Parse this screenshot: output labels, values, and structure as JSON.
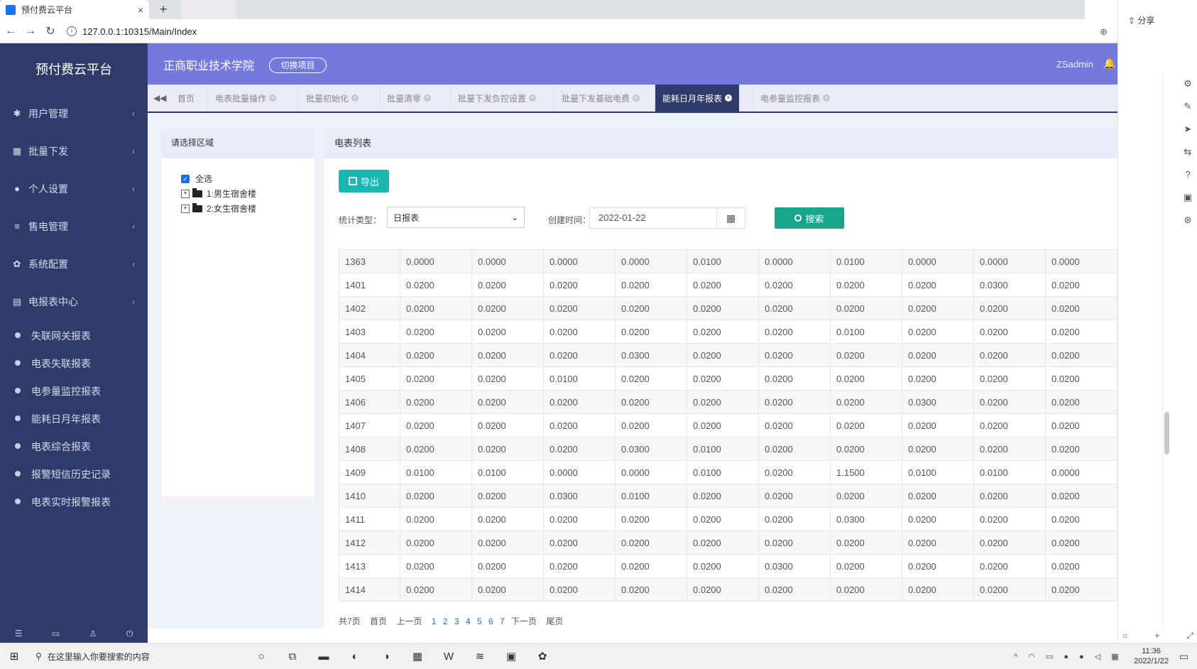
{
  "browser": {
    "tab_title": "预付费云平台",
    "tab_close": "×",
    "new_tab": "+",
    "back": "←",
    "forward": "→",
    "reload": "↻",
    "info": "i",
    "url": "127.0.0.1:10315/Main/Index",
    "zoom": "⊕",
    "share": "分享",
    "side_tools": [
      "⚙",
      "✎",
      "➤",
      "⇆",
      "?",
      "▣",
      "⊛"
    ],
    "side_bottom": [
      "○",
      "+",
      "⤢"
    ]
  },
  "sidebar": {
    "brand": "预付费云平台",
    "menu": [
      {
        "label": "用户管理",
        "icon": "✱"
      },
      {
        "label": "批量下发",
        "icon": "▦"
      },
      {
        "label": "个人设置",
        "icon": "●"
      },
      {
        "label": "售电管理",
        "icon": "≡"
      },
      {
        "label": "系统配置",
        "icon": "✿"
      },
      {
        "label": "电报表中心",
        "icon": "▤"
      }
    ],
    "chevron": "‹",
    "submenu": [
      "失联网关报表",
      "电表失联报表",
      "电参量监控报表",
      "能耗日月年报表",
      "电表综合报表",
      "报警短信历史记录",
      "电表实时报警报表"
    ],
    "footer_icons": [
      "☰",
      "▭",
      "♙",
      "⏻"
    ]
  },
  "header": {
    "org_name": "正商职业技术学院",
    "switch_label": "切换项目",
    "user": "ZSadmin",
    "bell": "🔔"
  },
  "tabs": {
    "back": "◀◀",
    "items": [
      "首页",
      "电表批量操作",
      "批量初始化",
      "批量清零",
      "批量下发负控设置",
      "批量下发基础电费",
      "能耗日月年报表",
      "电参量监控报表"
    ],
    "close": "×"
  },
  "region": {
    "title": "请选择区域",
    "check_all": "全选",
    "check_mark": "✓",
    "plus": "+",
    "nodes": [
      "1:男生宿舍楼",
      "2:女生宿舍楼"
    ]
  },
  "meters": {
    "title": "电表列表",
    "export_label": "导出",
    "stat_type_label": "统计类型：",
    "stat_type_value": "日报表",
    "select_arrow": "⌄",
    "create_time_label": "创建时间：",
    "create_time_value": "2022-01-22",
    "calendar_icon": "▦",
    "search_label": "搜索",
    "rows": [
      [
        "1363",
        "0.0000",
        "0.0000",
        "0.0000",
        "0.0000",
        "0.0100",
        "0.0000",
        "0.0100",
        "0.0000",
        "0.0000",
        "0.0000"
      ],
      [
        "1401",
        "0.0200",
        "0.0200",
        "0.0200",
        "0.0200",
        "0.0200",
        "0.0200",
        "0.0200",
        "0.0200",
        "0.0300",
        "0.0200"
      ],
      [
        "1402",
        "0.0200",
        "0.0200",
        "0.0200",
        "0.0200",
        "0.0200",
        "0.0200",
        "0.0200",
        "0.0200",
        "0.0200",
        "0.0200"
      ],
      [
        "1403",
        "0.0200",
        "0.0200",
        "0.0200",
        "0.0200",
        "0.0200",
        "0.0200",
        "0.0100",
        "0.0200",
        "0.0200",
        "0.0200"
      ],
      [
        "1404",
        "0.0200",
        "0.0200",
        "0.0200",
        "0.0300",
        "0.0200",
        "0.0200",
        "0.0200",
        "0.0200",
        "0.0200",
        "0.0200"
      ],
      [
        "1405",
        "0.0200",
        "0.0200",
        "0.0100",
        "0.0200",
        "0.0200",
        "0.0200",
        "0.0200",
        "0.0200",
        "0.0200",
        "0.0200"
      ],
      [
        "1406",
        "0.0200",
        "0.0200",
        "0.0200",
        "0.0200",
        "0.0200",
        "0.0200",
        "0.0200",
        "0.0300",
        "0.0200",
        "0.0200"
      ],
      [
        "1407",
        "0.0200",
        "0.0200",
        "0.0200",
        "0.0200",
        "0.0200",
        "0.0200",
        "0.0200",
        "0.0200",
        "0.0200",
        "0.0200"
      ],
      [
        "1408",
        "0.0200",
        "0.0200",
        "0.0200",
        "0.0300",
        "0.0100",
        "0.0200",
        "0.0200",
        "0.0200",
        "0.0200",
        "0.0200"
      ],
      [
        "1409",
        "0.0100",
        "0.0100",
        "0.0000",
        "0.0000",
        "0.0100",
        "0.0200",
        "1.1500",
        "0.0100",
        "0.0100",
        "0.0000"
      ],
      [
        "1410",
        "0.0200",
        "0.0200",
        "0.0300",
        "0.0100",
        "0.0200",
        "0.0200",
        "0.0200",
        "0.0200",
        "0.0200",
        "0.0200"
      ],
      [
        "1411",
        "0.0200",
        "0.0200",
        "0.0200",
        "0.0200",
        "0.0200",
        "0.0200",
        "0.0300",
        "0.0200",
        "0.0200",
        "0.0200"
      ],
      [
        "1412",
        "0.0200",
        "0.0200",
        "0.0200",
        "0.0200",
        "0.0200",
        "0.0200",
        "0.0200",
        "0.0200",
        "0.0200",
        "0.0200"
      ],
      [
        "1413",
        "0.0200",
        "0.0200",
        "0.0200",
        "0.0200",
        "0.0200",
        "0.0300",
        "0.0200",
        "0.0200",
        "0.0200",
        "0.0200"
      ],
      [
        "1414",
        "0.0200",
        "0.0200",
        "0.0200",
        "0.0200",
        "0.0200",
        "0.0200",
        "0.0200",
        "0.0200",
        "0.0200",
        "0.0200"
      ]
    ],
    "pager": {
      "total": "共7页",
      "first": "首页",
      "prev": "上一页",
      "pages": [
        "1",
        "2",
        "3",
        "4",
        "5",
        "6",
        "7"
      ],
      "next": "下一页",
      "last": "尾页"
    }
  },
  "taskbar": {
    "start": "⊞",
    "search_icon": "⚲",
    "search_placeholder": "在这里输入你要搜索的内容",
    "apps": [
      "○",
      "⧉",
      "▬",
      "◐",
      "◑",
      "▦",
      "W",
      "≋",
      "▣",
      "✿"
    ],
    "tray_icons": "^ ◠ ▭ ● ● ◁ ▦",
    "time": "11:36",
    "date": "2022/1/22",
    "notify": "▭"
  }
}
